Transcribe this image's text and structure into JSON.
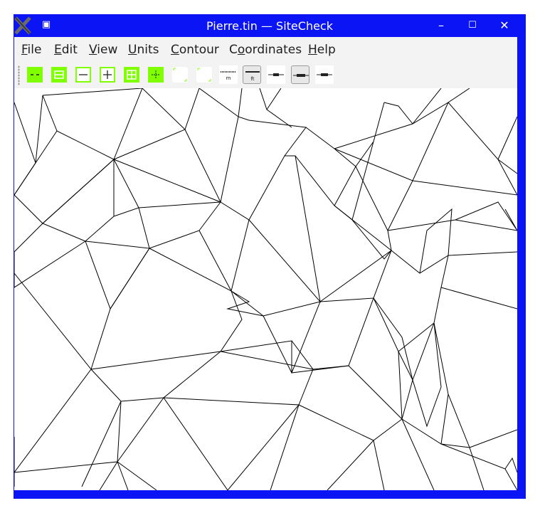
{
  "window": {
    "title": "Pierre.tin — SiteCheck",
    "controls": {
      "minimize": "–",
      "maximize": "☐",
      "close": "✕"
    },
    "frame_color": "#0a14f5"
  },
  "menubar": {
    "items": [
      {
        "label": "File",
        "accel": "F",
        "rest": "ile"
      },
      {
        "label": "Edit",
        "accel": "E",
        "rest": "dit"
      },
      {
        "label": "View",
        "accel": "V",
        "rest": "iew"
      },
      {
        "label": "Units",
        "accel": "U",
        "rest": "nits"
      },
      {
        "label": "Contour",
        "accel": "C",
        "rest": "ontour"
      },
      {
        "label": "Coordinates",
        "accel": "o",
        "pre": "C",
        "rest": "ordinates"
      },
      {
        "label": "Help",
        "accel": "H",
        "rest": "elp"
      }
    ]
  },
  "toolbar": {
    "accent": "#7fff00",
    "buttons": [
      {
        "icon": "zoom-out-both-icon"
      },
      {
        "icon": "zoom-in-both-icon"
      },
      {
        "icon": "zoom-out-icon"
      },
      {
        "icon": "zoom-in-icon"
      },
      {
        "icon": "grid-icon"
      },
      {
        "icon": "crosshair-icon"
      },
      {
        "icon": "blank-icon"
      },
      {
        "icon": "blank-icon"
      },
      {
        "icon": "scale-m-icon",
        "label": "m"
      },
      {
        "icon": "scale-ft-icon",
        "label": "ft",
        "pressed": true
      },
      {
        "icon": "line-thin-icon"
      },
      {
        "icon": "line-medium-icon",
        "pressed": true
      },
      {
        "icon": "line-thick-icon"
      }
    ]
  }
}
